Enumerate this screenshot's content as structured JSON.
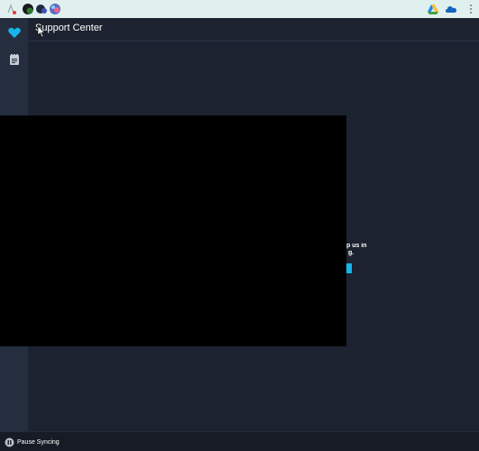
{
  "header": {
    "title": "Support Center"
  },
  "peek_text": {
    "line1": "p us in",
    "line2": "g."
  },
  "bottombar": {
    "pause_label": "Pause Syncing"
  },
  "colors": {
    "accent": "#18b4e8",
    "sidebar": "#252e3e",
    "content_bg": "#1c2230",
    "topbar": "#e0f0ef"
  },
  "icons": {
    "topbar_left": [
      "extension-icon",
      "profile-icon",
      "bird-icon",
      "app-icon"
    ],
    "topbar_right": [
      "drive-icon",
      "cloud-icon",
      "more-icon"
    ],
    "sidebar": [
      "heart-icon",
      "notepad-icon"
    ],
    "bottom": [
      "pause-icon"
    ]
  }
}
